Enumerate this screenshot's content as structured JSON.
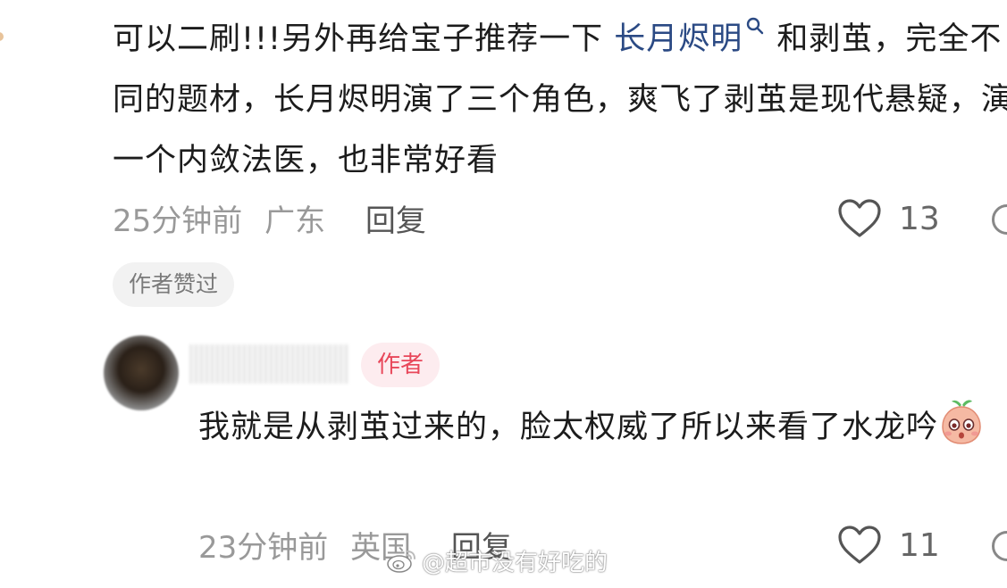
{
  "comment1": {
    "text_before": "可以二刷!!!另外再给宝子推荐一下 ",
    "mention": "长月烬明",
    "text_after": " 和剥茧，完全不同的题材，长月烬明演了三个角色，爽飞了剥茧是现代悬疑，演一个内敛法医，也非常好看",
    "time": "25分钟前",
    "location": "广东",
    "reply_label": "回复",
    "like_count": "13",
    "author_liked_badge": "作者赞过"
  },
  "reply1": {
    "author_badge": "作者",
    "text": "我就是从剥茧过来的，脸太权威了所以来看了水龙吟",
    "time": "23分钟前",
    "location": "英国",
    "reply_label": "回复",
    "like_count": "11"
  },
  "watermark": "@超市没有好吃的",
  "colors": {
    "mention": "#2b4a84",
    "author_badge_bg": "#fdecef",
    "author_badge_text": "#e8475a",
    "meta_text": "#999999"
  }
}
